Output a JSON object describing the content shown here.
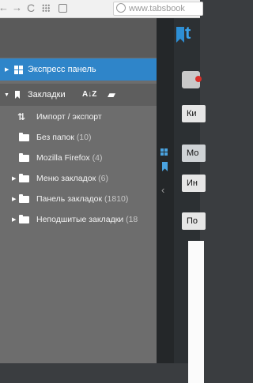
{
  "browser": {
    "address_text": "www.tabsbook"
  },
  "sidebar": {
    "express_panel_label": "Экспресс панель",
    "bookmarks_label": "Закладки",
    "sort_label": "A↓Z",
    "items": [
      {
        "label": "Импорт / экспорт",
        "count": "",
        "has_arrow": false,
        "icon": "import-export-icon"
      },
      {
        "label": "Без папок",
        "count": "(10)",
        "has_arrow": false,
        "icon": "folder-icon"
      },
      {
        "label": "Mozilla Firefox",
        "count": "(4)",
        "has_arrow": false,
        "icon": "folder-icon"
      },
      {
        "label": "Меню закладок",
        "count": "(6)",
        "has_arrow": true,
        "icon": "folder-icon"
      },
      {
        "label": "Панель закладок",
        "count": "(1810)",
        "has_arrow": true,
        "icon": "folder-icon"
      },
      {
        "label": "Неподшитые закладки",
        "count": "(18",
        "has_arrow": true,
        "icon": "folder-icon"
      }
    ]
  },
  "content": {
    "logo_text": "t",
    "buttons": [
      "Ки",
      "Мо",
      "Ин",
      "По"
    ]
  },
  "colors": {
    "accent": "#2f85c9",
    "panel_bg": "#6d6d6d"
  }
}
